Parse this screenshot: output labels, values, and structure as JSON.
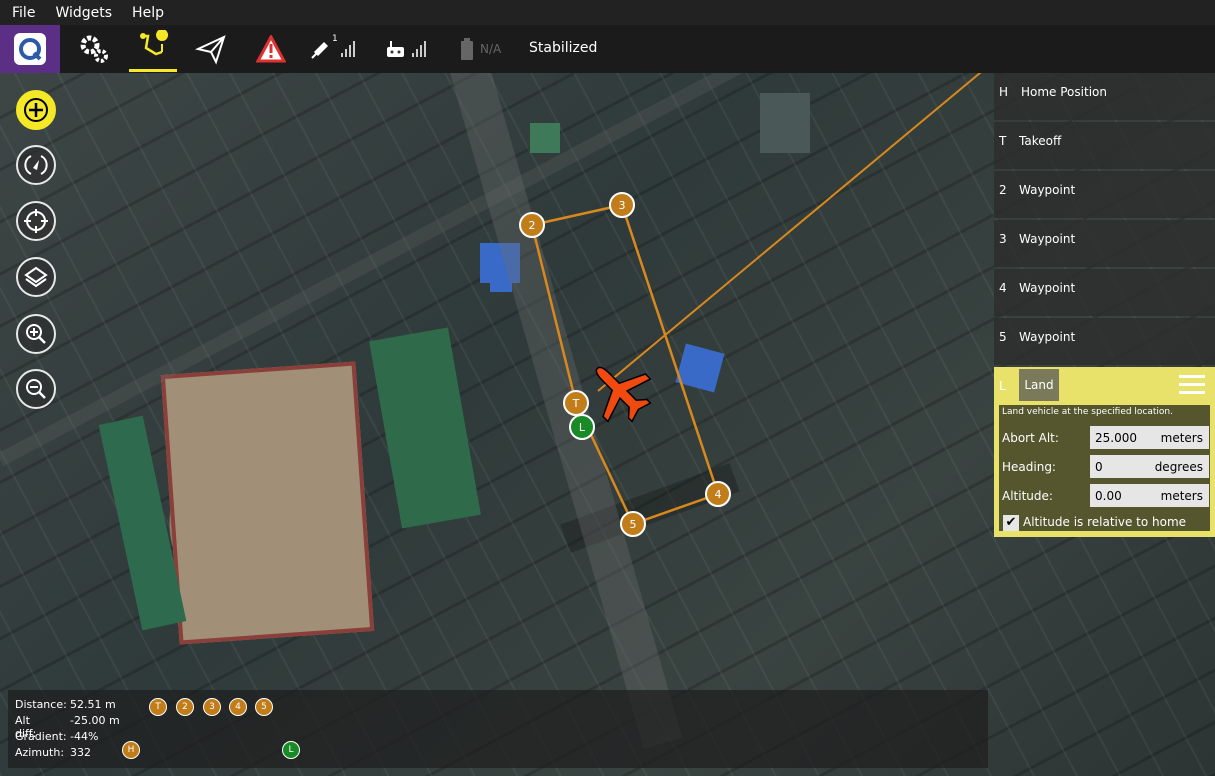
{
  "menu": {
    "items": [
      "File",
      "Widgets",
      "Help"
    ]
  },
  "toolbar": {
    "gps_count": "1",
    "battery_text": "N/A",
    "flight_mode": "Stabilized"
  },
  "map_markers": {
    "home": "H",
    "takeoff": "T",
    "land": "L",
    "waypoints": [
      "2",
      "3",
      "4",
      "5"
    ]
  },
  "mission": {
    "items": [
      {
        "num": "H",
        "label": "Home Position"
      },
      {
        "num": "T",
        "label": "Takeoff"
      },
      {
        "num": "2",
        "label": "Waypoint"
      },
      {
        "num": "3",
        "label": "Waypoint"
      },
      {
        "num": "4",
        "label": "Waypoint"
      },
      {
        "num": "5",
        "label": "Waypoint"
      }
    ],
    "selected": {
      "num": "L",
      "label": "Land",
      "description": "Land vehicle at the specified location.",
      "fields": [
        {
          "label": "Abort Alt:",
          "value": "25.000",
          "unit": "meters"
        },
        {
          "label": "Heading:",
          "value": "0",
          "unit": "degrees"
        },
        {
          "label": "Altitude:",
          "value": "0.00",
          "unit": "meters"
        }
      ],
      "checkbox_label": "Altitude is relative to home",
      "checkbox_checked": true
    }
  },
  "stats": {
    "rows": [
      {
        "key": "Distance:",
        "value": "52.51 m"
      },
      {
        "key": "Alt diff:",
        "value": "-25.00 m"
      },
      {
        "key": "Gradient:",
        "value": "-44%"
      },
      {
        "key": "Azimuth:",
        "value": "332"
      }
    ],
    "markers": [
      "T",
      "2",
      "3",
      "4",
      "5"
    ],
    "home_marker": "H",
    "land_marker": "L"
  },
  "colors": {
    "accent_yellow": "#f4e827",
    "waypoint_orange": "#c27d1b",
    "land_green": "#198a26",
    "vehicle_red": "#f04a10",
    "logo_purple": "#5b2f85"
  }
}
